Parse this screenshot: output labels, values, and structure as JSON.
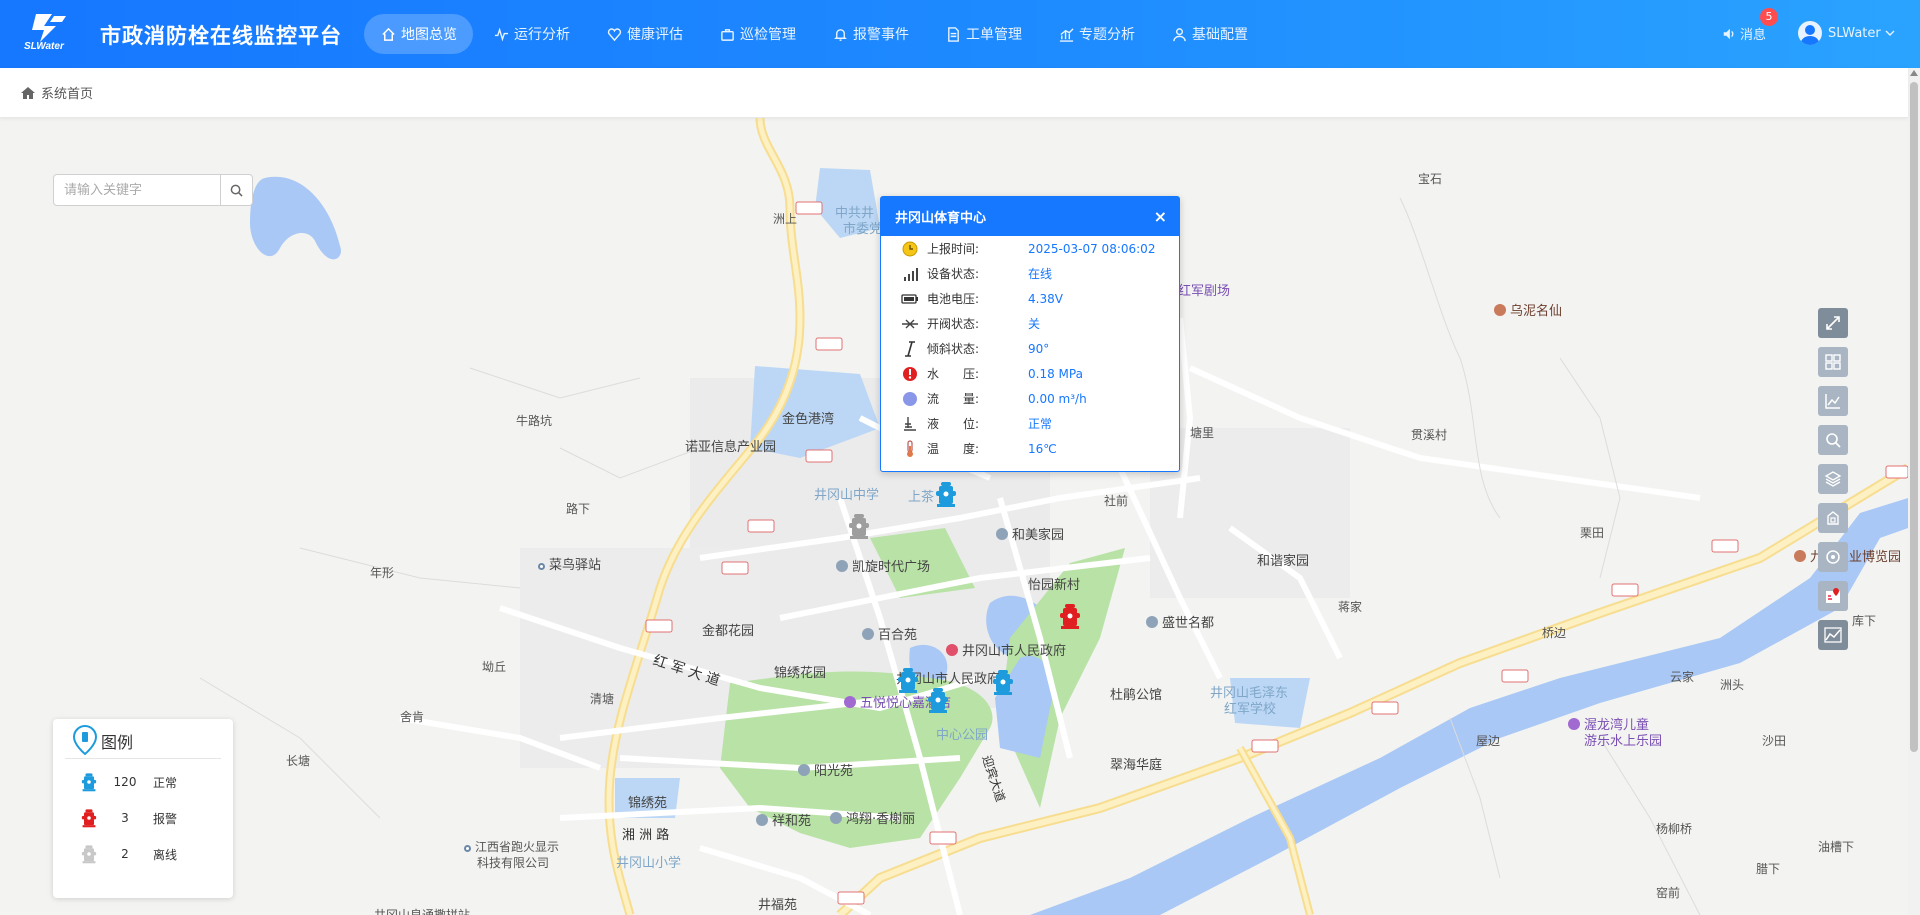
{
  "app": {
    "logo_text": "SLWater",
    "title": "市政消防栓在线监控平台",
    "brand_color": "#1677ff"
  },
  "nav": [
    {
      "label": "地图总览",
      "icon": "home-icon",
      "active": true
    },
    {
      "label": "运行分析",
      "icon": "pulse-icon"
    },
    {
      "label": "健康评估",
      "icon": "heart-icon"
    },
    {
      "label": "巡检管理",
      "icon": "briefcase-icon"
    },
    {
      "label": "报警事件",
      "icon": "bell-icon"
    },
    {
      "label": "工单管理",
      "icon": "document-icon"
    },
    {
      "label": "专题分析",
      "icon": "bar-chart-icon"
    },
    {
      "label": "基础配置",
      "icon": "user-gear-icon"
    }
  ],
  "header": {
    "message_label": "消息",
    "message_count": "5",
    "username": "SLWater"
  },
  "breadcrumb": {
    "label": "系统首页"
  },
  "search": {
    "placeholder": "请输入关键字",
    "value": ""
  },
  "popup": {
    "title": "井冈山体育中心",
    "close": "×",
    "rows": [
      {
        "key": "上报时间:",
        "value": "2025-03-07  08:06:02",
        "icon": "clock-icon"
      },
      {
        "key": "设备状态:",
        "value": "在线",
        "icon": "signal-icon"
      },
      {
        "key": "电池电压:",
        "value": "4.38V",
        "icon": "battery-icon"
      },
      {
        "key": "开阀状态:",
        "value": "关",
        "icon": "valve-icon"
      },
      {
        "key": "倾斜状态:",
        "value": "90°",
        "icon": "tilt-icon"
      },
      {
        "key": "水　　压:",
        "value": "0.18 MPa",
        "icon": "pressure-gauge-icon"
      },
      {
        "key": "流　　量:",
        "value": "0.00 m³/h",
        "icon": "flow-icon"
      },
      {
        "key": "液　　位:",
        "value": "正常",
        "icon": "level-icon"
      },
      {
        "key": "温　　度:",
        "value": "16℃",
        "icon": "thermometer-icon"
      }
    ]
  },
  "legend": {
    "title": "图例",
    "items": [
      {
        "count": "120",
        "label": "正常",
        "color": "#1e9bdc"
      },
      {
        "count": "3",
        "label": "报警",
        "color": "#e02020"
      },
      {
        "count": "2",
        "label": "离线",
        "color": "#bdbdbd"
      }
    ]
  },
  "map_labels": {
    "baoshi": "宝石",
    "zhoushang": "洲上",
    "zhonggong": "中共井",
    "shiwei": "市委党",
    "hongjun_theater": "红军剧场",
    "wunixian": "乌泥名仙",
    "niulukeng": "牛路坑",
    "jinse_gangwan": "金色港湾",
    "nuoya": "诺亚信息产业园",
    "tangli": "塘里",
    "guanxicun": "贯溪村",
    "jinggangshan_middle": "井冈山中学",
    "shangcha": "上茶",
    "shegian": "社前",
    "luxia": "路下",
    "hemei": "和美家园",
    "cainiao": "菜鸟驿站",
    "kaixuan": "凯旋时代广场",
    "nianxing": "年形",
    "yiyuan": "怡园新村",
    "hexie": "和谐家园",
    "lizigou": "栗田",
    "agri_expo": "九井农业博览园",
    "hejia": "蒋家",
    "jindu": "金都花园",
    "baihe": "百合苑",
    "shengshi": "盛世名都",
    "qiaobian": "桥边",
    "kuxia": "库下",
    "gov1": "井冈山市人民政府",
    "aoqiu": "坳丘",
    "hongjun_road": "红 军 大 道",
    "jinxiu": "锦绣花园",
    "gov2": "井冈山市人民政府",
    "qingtang": "清塘",
    "wuyue": "五悦悦心嘉酒店",
    "dupeng": "杜鹃公馆",
    "mao_school": "井冈山毛泽东",
    "mao_school2": "红军学校",
    "yunjia": "云家",
    "zhoutou": "洲头",
    "kids": "渥龙湾儿童",
    "kids2": "游乐水上乐园",
    "sheken": "舍肯",
    "center_park": "中心公园",
    "wuxia": "屋边",
    "shatian": "沙田",
    "changtang": "长塘",
    "yangguang": "阳光苑",
    "cuihai": "翠海华庭",
    "yingbin": "迎宾大道",
    "jinxiuyuan": "锦绣苑",
    "xianghe": "祥和苑",
    "hongxiang": "鸿翔·香榭丽",
    "xiangzhou": "湘 洲 路",
    "jiangxi_co": "江西省跑火显示",
    "jiangxi_co2": "科技有限公司",
    "yangliu": "杨柳桥",
    "primary_school": "井冈山小学",
    "youtang": "油槽下",
    "jingfu": "井福苑",
    "laxia": "腊下",
    "yaqian": "窑前",
    "bottom_cut": "井冈山良通撒拼站"
  }
}
